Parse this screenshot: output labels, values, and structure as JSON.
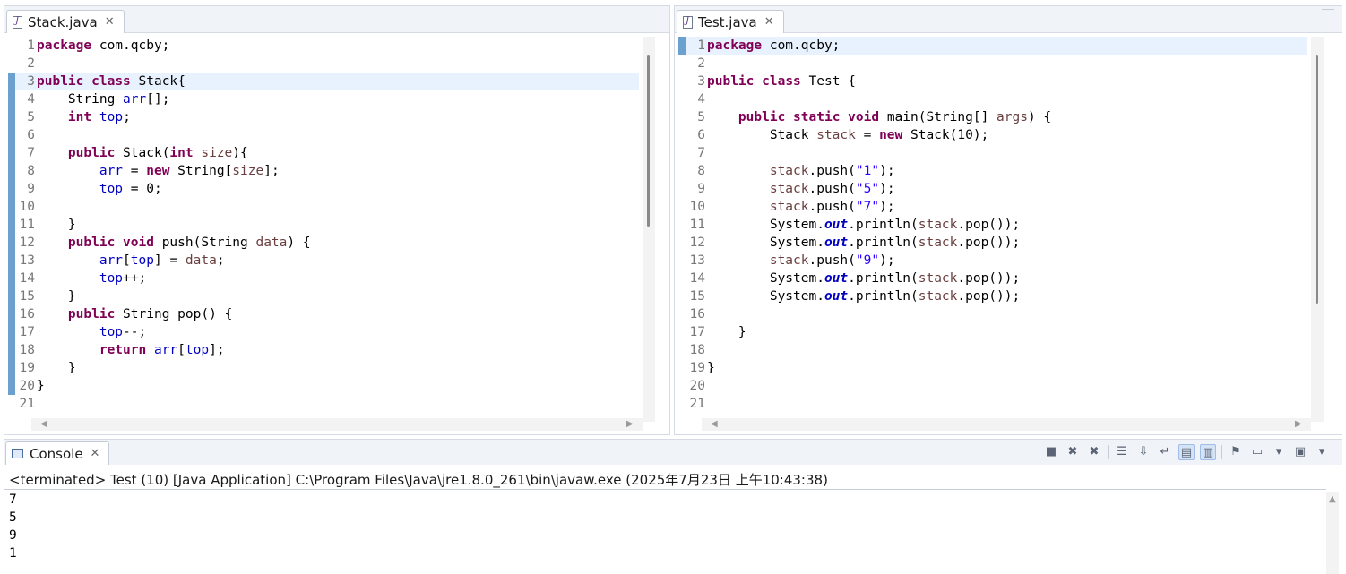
{
  "left_editor": {
    "tab_title": "Stack.java",
    "close_glyph": "✕",
    "current_line": 3,
    "marked_lines": [
      3,
      4,
      5,
      6,
      7,
      8,
      9,
      10,
      11,
      12,
      13,
      14,
      15,
      16,
      17,
      18,
      19,
      20
    ],
    "lines": [
      [
        [
          "kw",
          "package"
        ],
        [
          "t",
          " com.qcby;"
        ]
      ],
      [],
      [
        [
          "kw",
          "public"
        ],
        [
          "t",
          " "
        ],
        [
          "kw",
          "class"
        ],
        [
          "t",
          " Stack{"
        ]
      ],
      [
        [
          "t",
          "    String "
        ],
        [
          "fld",
          "arr"
        ],
        [
          "t",
          "[];"
        ]
      ],
      [
        [
          "t",
          "    "
        ],
        [
          "kw",
          "int"
        ],
        [
          "t",
          " "
        ],
        [
          "fld",
          "top"
        ],
        [
          "t",
          ";"
        ]
      ],
      [],
      [
        [
          "t",
          "    "
        ],
        [
          "kw",
          "public"
        ],
        [
          "t",
          " Stack("
        ],
        [
          "kw",
          "int"
        ],
        [
          "t",
          " "
        ],
        [
          "var",
          "size"
        ],
        [
          "t",
          "){"
        ]
      ],
      [
        [
          "t",
          "        "
        ],
        [
          "fld",
          "arr"
        ],
        [
          "t",
          " = "
        ],
        [
          "kw",
          "new"
        ],
        [
          "t",
          " String["
        ],
        [
          "var",
          "size"
        ],
        [
          "t",
          "];"
        ]
      ],
      [
        [
          "t",
          "        "
        ],
        [
          "fld",
          "top"
        ],
        [
          "t",
          " = 0;"
        ]
      ],
      [],
      [
        [
          "t",
          "    }"
        ]
      ],
      [
        [
          "t",
          "    "
        ],
        [
          "kw",
          "public"
        ],
        [
          "t",
          " "
        ],
        [
          "kw",
          "void"
        ],
        [
          "t",
          " push(String "
        ],
        [
          "var",
          "data"
        ],
        [
          "t",
          ") {"
        ]
      ],
      [
        [
          "t",
          "        "
        ],
        [
          "fld",
          "arr"
        ],
        [
          "t",
          "["
        ],
        [
          "fld",
          "top"
        ],
        [
          "t",
          "] = "
        ],
        [
          "var",
          "data"
        ],
        [
          "t",
          ";"
        ]
      ],
      [
        [
          "t",
          "        "
        ],
        [
          "fld",
          "top"
        ],
        [
          "t",
          "++;"
        ]
      ],
      [
        [
          "t",
          "    }"
        ]
      ],
      [
        [
          "t",
          "    "
        ],
        [
          "kw",
          "public"
        ],
        [
          "t",
          " String pop() {"
        ]
      ],
      [
        [
          "t",
          "        "
        ],
        [
          "fld",
          "top"
        ],
        [
          "t",
          "--;"
        ]
      ],
      [
        [
          "t",
          "        "
        ],
        [
          "kw",
          "return"
        ],
        [
          "t",
          " "
        ],
        [
          "fld",
          "arr"
        ],
        [
          "t",
          "["
        ],
        [
          "fld",
          "top"
        ],
        [
          "t",
          "];"
        ]
      ],
      [
        [
          "t",
          "    }"
        ]
      ],
      [
        [
          "t",
          "}"
        ]
      ],
      []
    ]
  },
  "right_editor": {
    "tab_title": "Test.java",
    "close_glyph": "✕",
    "current_line": 1,
    "marked_lines": [
      1
    ],
    "lines": [
      [
        [
          "kw",
          "package"
        ],
        [
          "t",
          " com.qcby;"
        ]
      ],
      [],
      [
        [
          "kw",
          "public"
        ],
        [
          "t",
          " "
        ],
        [
          "kw",
          "class"
        ],
        [
          "t",
          " Test {"
        ]
      ],
      [],
      [
        [
          "t",
          "    "
        ],
        [
          "kw",
          "public"
        ],
        [
          "t",
          " "
        ],
        [
          "kw",
          "static"
        ],
        [
          "t",
          " "
        ],
        [
          "kw",
          "void"
        ],
        [
          "t",
          " main(String[] "
        ],
        [
          "var",
          "args"
        ],
        [
          "t",
          ") {"
        ]
      ],
      [
        [
          "t",
          "        Stack "
        ],
        [
          "var",
          "stack"
        ],
        [
          "t",
          " = "
        ],
        [
          "kw",
          "new"
        ],
        [
          "t",
          " Stack(10);"
        ]
      ],
      [],
      [
        [
          "t",
          "        "
        ],
        [
          "var",
          "stack"
        ],
        [
          "t",
          ".push("
        ],
        [
          "str",
          "\"1\""
        ],
        [
          "t",
          ");"
        ]
      ],
      [
        [
          "t",
          "        "
        ],
        [
          "var",
          "stack"
        ],
        [
          "t",
          ".push("
        ],
        [
          "str",
          "\"5\""
        ],
        [
          "t",
          ");"
        ]
      ],
      [
        [
          "t",
          "        "
        ],
        [
          "var",
          "stack"
        ],
        [
          "t",
          ".push("
        ],
        [
          "str",
          "\"7\""
        ],
        [
          "t",
          ");"
        ]
      ],
      [
        [
          "t",
          "        System."
        ],
        [
          "sfld",
          "out"
        ],
        [
          "t",
          ".println("
        ],
        [
          "var",
          "stack"
        ],
        [
          "t",
          ".pop());"
        ]
      ],
      [
        [
          "t",
          "        System."
        ],
        [
          "sfld",
          "out"
        ],
        [
          "t",
          ".println("
        ],
        [
          "var",
          "stack"
        ],
        [
          "t",
          ".pop());"
        ]
      ],
      [
        [
          "t",
          "        "
        ],
        [
          "var",
          "stack"
        ],
        [
          "t",
          ".push("
        ],
        [
          "str",
          "\"9\""
        ],
        [
          "t",
          ");"
        ]
      ],
      [
        [
          "t",
          "        System."
        ],
        [
          "sfld",
          "out"
        ],
        [
          "t",
          ".println("
        ],
        [
          "var",
          "stack"
        ],
        [
          "t",
          ".pop());"
        ]
      ],
      [
        [
          "t",
          "        System."
        ],
        [
          "sfld",
          "out"
        ],
        [
          "t",
          ".println("
        ],
        [
          "var",
          "stack"
        ],
        [
          "t",
          ".pop());"
        ]
      ],
      [],
      [
        [
          "t",
          "    }"
        ]
      ],
      [],
      [
        [
          "t",
          "}"
        ]
      ],
      [],
      []
    ]
  },
  "console": {
    "tab_title": "Console",
    "close_glyph": "✕",
    "status": "<terminated> Test (10) [Java Application] C:\\Program Files\\Java\\jre1.8.0_261\\bin\\javaw.exe (2025年7月23日 上午10:43:38)",
    "output": [
      "7",
      "5",
      "9",
      "1"
    ],
    "toolbar": [
      {
        "name": "stop-icon",
        "glyph": "■"
      },
      {
        "name": "remove-launch-icon",
        "glyph": "✖"
      },
      {
        "name": "remove-all-terminated-icon",
        "glyph": "✖"
      },
      {
        "name": "sep"
      },
      {
        "name": "clear-console-icon",
        "glyph": "☰"
      },
      {
        "name": "scroll-lock-icon",
        "glyph": "⇩"
      },
      {
        "name": "word-wrap-icon",
        "glyph": "↵"
      },
      {
        "name": "show-on-stdout-icon",
        "glyph": "▤",
        "on": true
      },
      {
        "name": "show-on-stderr-icon",
        "glyph": "▥",
        "on": true
      },
      {
        "name": "sep"
      },
      {
        "name": "pin-console-icon",
        "glyph": "⚑"
      },
      {
        "name": "display-console-icon",
        "glyph": "▭"
      },
      {
        "name": "display-console-dropdown-icon",
        "glyph": "▾"
      },
      {
        "name": "open-console-icon",
        "glyph": "▣"
      },
      {
        "name": "open-console-dropdown-icon",
        "glyph": "▾"
      }
    ]
  }
}
